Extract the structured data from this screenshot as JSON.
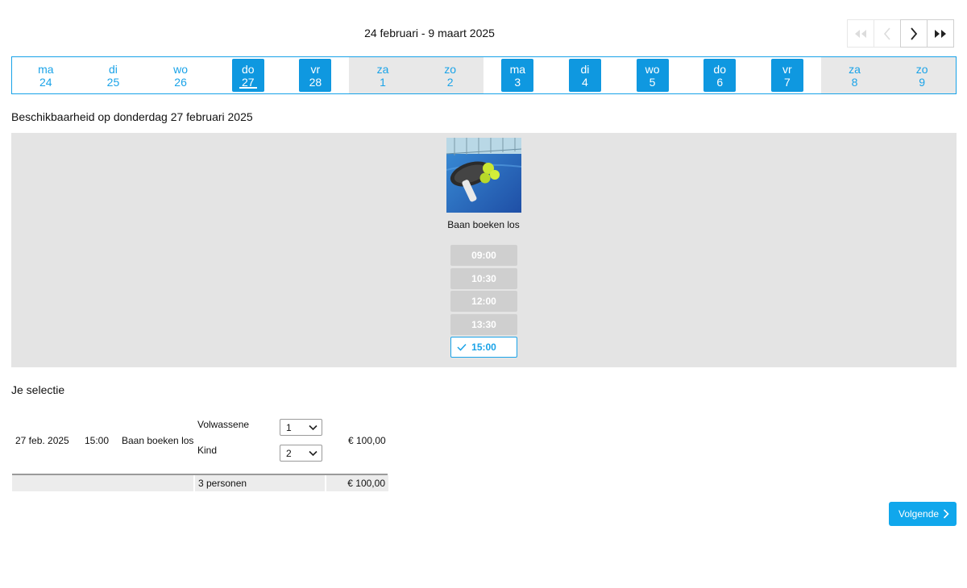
{
  "header": {
    "date_range": "24 februari - 9 maart 2025"
  },
  "days": [
    {
      "dow": "ma",
      "num": "24",
      "state": "plain"
    },
    {
      "dow": "di",
      "num": "25",
      "state": "plain"
    },
    {
      "dow": "wo",
      "num": "26",
      "state": "plain"
    },
    {
      "dow": "do",
      "num": "27",
      "state": "selected"
    },
    {
      "dow": "vr",
      "num": "28",
      "state": "available"
    },
    {
      "dow": "za",
      "num": "1",
      "state": "weekend"
    },
    {
      "dow": "zo",
      "num": "2",
      "state": "weekend"
    },
    {
      "dow": "ma",
      "num": "3",
      "state": "available"
    },
    {
      "dow": "di",
      "num": "4",
      "state": "available"
    },
    {
      "dow": "wo",
      "num": "5",
      "state": "available"
    },
    {
      "dow": "do",
      "num": "6",
      "state": "available"
    },
    {
      "dow": "vr",
      "num": "7",
      "state": "available"
    },
    {
      "dow": "za",
      "num": "8",
      "state": "weekend"
    },
    {
      "dow": "zo",
      "num": "9",
      "state": "weekend"
    }
  ],
  "availability": {
    "title": "Beschikbaarheid op donderdag 27 februari 2025",
    "product_name": "Baan boeken los",
    "slots": [
      {
        "time": "09:00",
        "selected": false
      },
      {
        "time": "10:30",
        "selected": false
      },
      {
        "time": "12:00",
        "selected": false
      },
      {
        "time": "13:30",
        "selected": false
      },
      {
        "time": "15:00",
        "selected": true
      }
    ]
  },
  "selection": {
    "title": "Je selectie",
    "date": "27 feb. 2025",
    "time": "15:00",
    "product": "Baan boeken los",
    "adult_label": "Volwassene",
    "adult_qty": "1",
    "child_label": "Kind",
    "child_qty": "2",
    "price": "€ 100,00",
    "total_persons": "3 personen",
    "total_price": "€ 100,00"
  },
  "next_label": "Volgende",
  "colors": {
    "accent": "#0f98e0",
    "weekend": "#e8e8e8",
    "panel": "#e4e4e4",
    "slot_disabled": "#cfcfcf"
  }
}
